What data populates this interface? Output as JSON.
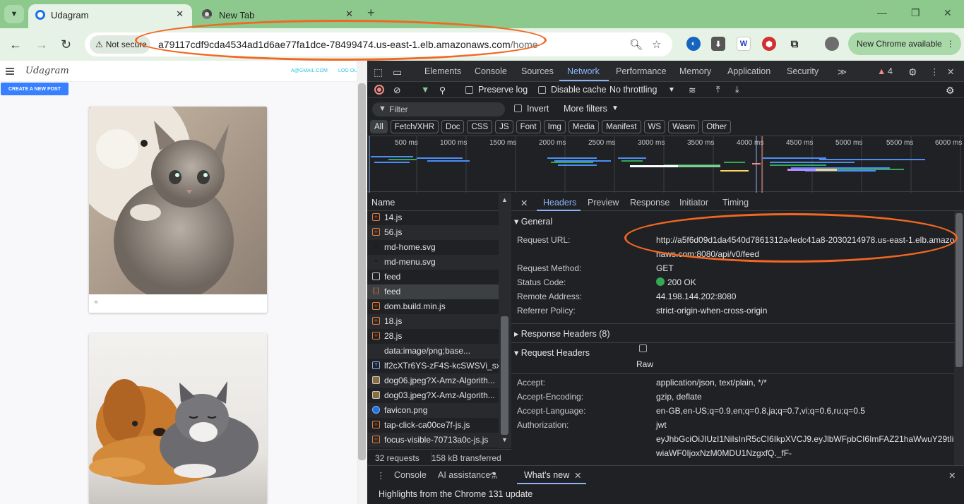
{
  "browser": {
    "tabs": [
      {
        "title": "Udagram",
        "active": true
      },
      {
        "title": "New Tab",
        "active": false
      }
    ],
    "omnibox": {
      "security": "Not secure",
      "host": "a79117cdf9cda4534ad1d6ae77fa1dce-78499474.us-east-1.elb.amazonaws.com",
      "path": "/home"
    },
    "update_button": "New Chrome available",
    "extensions": [
      "blue-globe-icon",
      "download-icon",
      "w-icon",
      "red-stop-icon",
      "puzzle-icon",
      "avatar"
    ]
  },
  "app": {
    "brand": "Udagram",
    "email": "A@GMAIL.COM",
    "logout": "LOG OUT",
    "create_button": "CREATE A NEW POST",
    "posts": [
      {
        "image": "kitten and white dog",
        "caption": "n"
      },
      {
        "image": "golden retriever and grey cat",
        "caption": ""
      }
    ]
  },
  "devtools": {
    "tabs": [
      "Elements",
      "Console",
      "Sources",
      "Network",
      "Performance",
      "Memory",
      "Application",
      "Security"
    ],
    "active_tab": "Network",
    "issues_count": "4",
    "network_bar": {
      "preserve_log": "Preserve log",
      "disable_cache": "Disable cache",
      "throttling": "No throttling"
    },
    "filter": {
      "placeholder": "Filter",
      "invert": "Invert",
      "more_filters": "More filters"
    },
    "type_chips": [
      "All",
      "Fetch/XHR",
      "Doc",
      "CSS",
      "JS",
      "Font",
      "Img",
      "Media",
      "Manifest",
      "WS",
      "Wasm",
      "Other"
    ],
    "timeline_ticks": [
      "500 ms",
      "1000 ms",
      "1500 ms",
      "2000 ms",
      "2500 ms",
      "3000 ms",
      "3500 ms",
      "4000 ms",
      "4500 ms",
      "5000 ms",
      "5500 ms",
      "6000 ms"
    ],
    "request_list": {
      "header": "Name",
      "items": [
        "14.js",
        "56.js",
        "md-home.svg",
        "md-menu.svg",
        "feed",
        "feed",
        "dom.build.min.js",
        "18.js",
        "28.js",
        "data:image/png;base...",
        "lf2cXTr6YS-zF4S-kcSWSVi_sx...",
        "dog06.jpeg?X-Amz-Algorith...",
        "dog03.jpeg?X-Amz-Algorith...",
        "favicon.png",
        "tap-click-ca00ce7f-js.js",
        "focus-visible-70713a0c-js.js"
      ],
      "selected_index": 5,
      "requests": "32 requests",
      "transferred": "158 kB transferred"
    },
    "detail_tabs": [
      "Headers",
      "Preview",
      "Response",
      "Initiator",
      "Timing"
    ],
    "active_detail_tab": "Headers",
    "general": {
      "title": "General",
      "request_url_label": "Request URL:",
      "request_url_line1": "http://a5f6d09d1da4540d7861312a4edc41a8-2030214978.us-east-1.elb.amazo",
      "request_url_line2": "naws.com:8080/api/v0/feed",
      "method_label": "Request Method:",
      "method": "GET",
      "status_label": "Status Code:",
      "status": "200 OK",
      "remote_label": "Remote Address:",
      "remote": "44.198.144.202:8080",
      "referrer_label": "Referrer Policy:",
      "referrer": "strict-origin-when-cross-origin"
    },
    "response_headers": "Response Headers (8)",
    "request_headers": {
      "title": "Request Headers",
      "raw": "Raw",
      "accept_label": "Accept:",
      "accept": "application/json, text/plain, */*",
      "encoding_label": "Accept-Encoding:",
      "encoding": "gzip, deflate",
      "language_label": "Accept-Language:",
      "language": "en-GB,en-US;q=0.9,en;q=0.8,ja;q=0.7,vi;q=0.6,ru;q=0.5",
      "auth_label": "Authorization:",
      "auth_line1": "jwt",
      "auth_line2": "eyJhbGciOiJIUzI1NiIsInR5cCI6IkpXVCJ9.eyJlbWFpbCI6ImFAZ21haWwuY29tIi",
      "auth_line3": "wiaWF0IjoxNzM0MDU1NzgxfQ._fF-"
    },
    "drawer": {
      "tabs": [
        "Console",
        "AI assistance",
        "What's new"
      ],
      "active": "What's new",
      "highlight": "Highlights from the Chrome 131 update"
    }
  },
  "colors": {
    "tabstrip": "#8dc88d",
    "devtools_bg": "#202124",
    "accent_blue": "#8ab4f8",
    "annotation_orange": "#f26722",
    "status_green": "#34a853"
  }
}
